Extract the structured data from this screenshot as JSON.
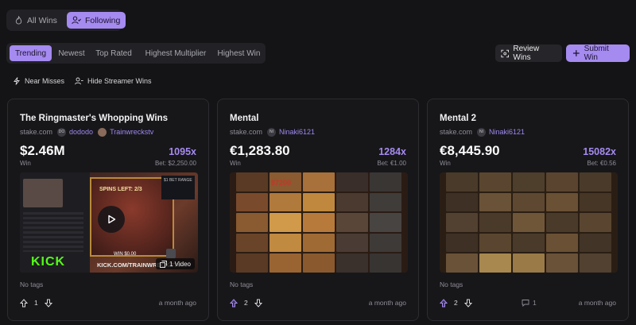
{
  "top_toggle": {
    "all_wins": "All Wins",
    "following": "Following"
  },
  "sort_tabs": [
    "Trending",
    "Newest",
    "Top Rated",
    "Highest Multiplier",
    "Highest Win"
  ],
  "actions": {
    "review": "Review Wins",
    "submit": "Submit Win"
  },
  "filters": {
    "near_misses": "Near Misses",
    "hide_streamer": "Hide Streamer Wins"
  },
  "cards": [
    {
      "title": "The Ringmaster's Whopping Wins",
      "site": "stake.com",
      "user_initials": "DO",
      "user": "dododo",
      "streamer": "Trainwreckstv",
      "amount": "$2.46M",
      "win_label": "Win",
      "multiplier": "1095x",
      "bet": "Bet: $2,250.00",
      "thumb": {
        "spins_text": "SPINS LEFT: 2/3",
        "win_strip": "WIN $0.00",
        "platform": "KICK",
        "url": "KICK.COM/TRAINWRECKSTV",
        "video_count": "1 Video",
        "badge_text": "$1 BET RANGE"
      },
      "tags": "No tags",
      "votes": "1",
      "time": "a month ago"
    },
    {
      "title": "Mental",
      "site": "stake.com",
      "user_initials": "NI",
      "user": "Ninaki6121",
      "amount": "€1,283.80",
      "win_label": "Win",
      "multiplier": "1284x",
      "bet": "Bet: €1.00",
      "thumb": {
        "score": "97200"
      },
      "tags": "No tags",
      "votes": "2",
      "time": "a month ago"
    },
    {
      "title": "Mental 2",
      "site": "stake.com",
      "user_initials": "NI",
      "user": "Ninaki6121",
      "amount": "€8,445.90",
      "win_label": "Win",
      "multiplier": "15082x",
      "bet": "Bet: €0.56",
      "thumb": {},
      "tags": "No tags",
      "votes": "2",
      "comments": "1",
      "time": "a month ago"
    }
  ],
  "colors": {
    "accent": "#a58af0",
    "background": "#141416",
    "card": "#17171a",
    "kick_green": "#53fc18"
  }
}
